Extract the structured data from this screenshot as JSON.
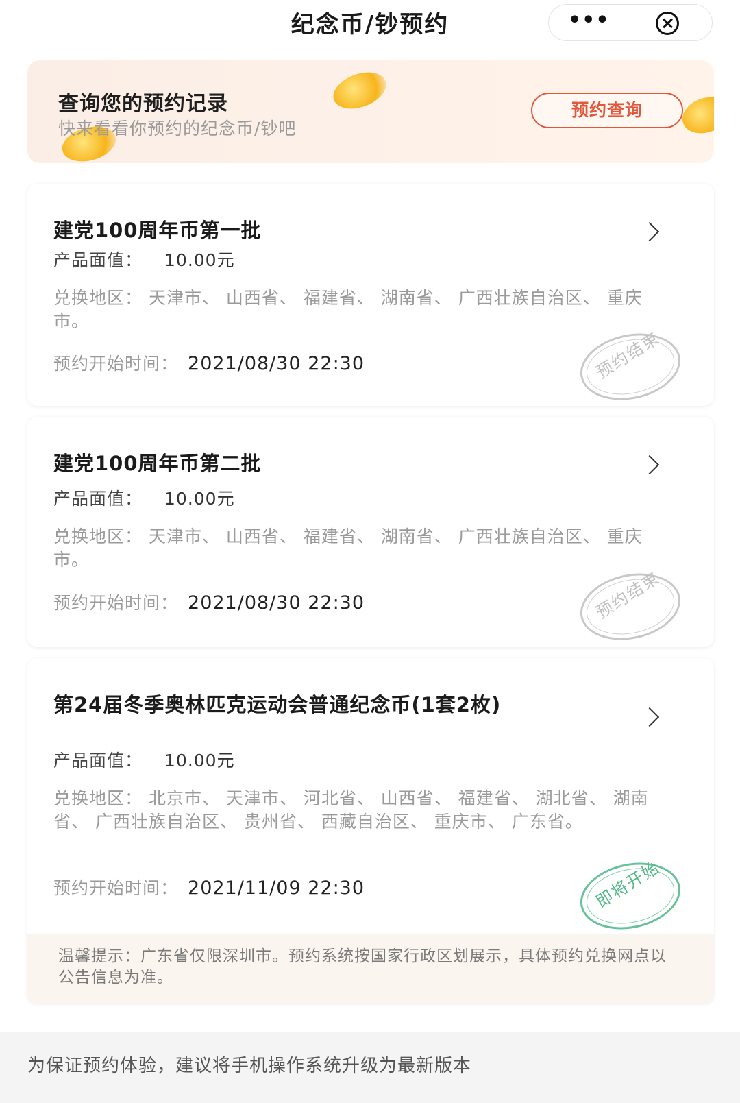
{
  "header": {
    "title": "纪念币/钞预约",
    "more_icon": "more-dots-icon",
    "close_icon": "close-circle-icon"
  },
  "banner": {
    "title": "查询您的预约记录",
    "subtitle": "快来看看你预约的纪念币/钞吧",
    "button_label": "预约查询"
  },
  "items": [
    {
      "title": "建党100周年币第一批",
      "face_label": "产品面值：",
      "face_value": "10.00元",
      "region": "兑换地区： 天津市、 山西省、 福建省、 湖南省、 广西壮族自治区、 重庆市。",
      "start_label": "预约开始时间：",
      "start_value": "2021/08/30 22:30",
      "stamp": "预约结束"
    },
    {
      "title": "建党100周年币第二批",
      "face_label": "产品面值：",
      "face_value": "10.00元",
      "region": "兑换地区： 天津市、 山西省、 福建省、 湖南省、 广西壮族自治区、 重庆市。",
      "start_label": "预约开始时间：",
      "start_value": "2021/08/30 22:30",
      "stamp": "预约结束"
    },
    {
      "title": "第24届冬季奥林匹克运动会普通纪念币(1套2枚)",
      "face_label": "产品面值：",
      "face_value": "10.00元",
      "region": "兑换地区： 北京市、 天津市、 河北省、 山西省、 福建省、 湖北省、 湖南省、 广西壮族自治区、 贵州省、 西藏自治区、 重庆市、 广东省。",
      "start_label": "预约开始时间：",
      "start_value": "2021/11/09 22:30",
      "stamp": "即将开始"
    }
  ],
  "tip": "温馨提示：广东省仅限深圳市。预约系统按国家行政区划展示，具体预约兑换网点以公告信息为准。",
  "footer": "为保证预约体验，建议将手机操作系统升级为最新版本",
  "colors": {
    "accent": "#e0573b",
    "stamp_gray": "#c8c8c8",
    "stamp_green": "#67c29a"
  }
}
